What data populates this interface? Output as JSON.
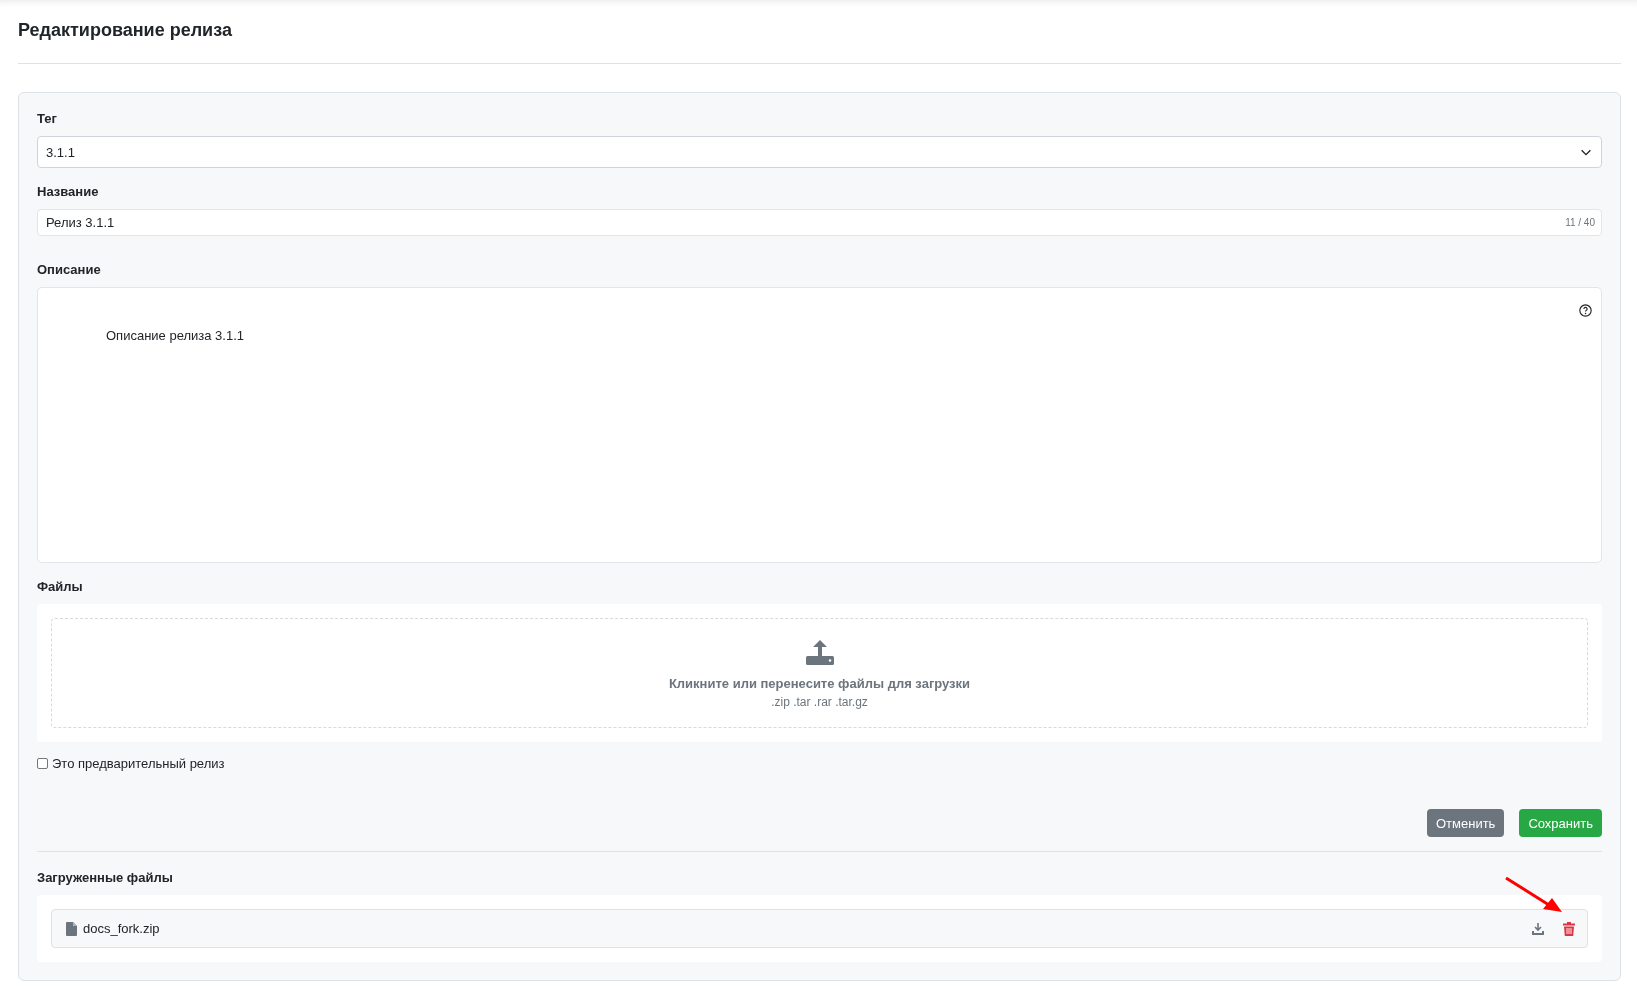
{
  "page": {
    "title": "Редактирование релиза"
  },
  "tag": {
    "label": "Тег",
    "value": "3.1.1"
  },
  "name": {
    "label": "Название",
    "value": "Релиз 3.1.1",
    "counter": "11 / 40"
  },
  "description": {
    "label": "Описание",
    "value": "Описание релиза 3.1.1"
  },
  "files": {
    "label": "Файлы",
    "dropzone_text": "Кликните или перенесите файлы для загрузки",
    "accepted_types": ".zip .tar .rar .tar.gz"
  },
  "prerelease": {
    "label": "Это предварительный релиз",
    "checked": false
  },
  "buttons": [
    {
      "kind": "cancel",
      "label": "Отменить"
    },
    {
      "kind": "save",
      "label": "Сохранить"
    }
  ],
  "uploaded": {
    "label": "Загруженные файлы",
    "items": [
      {
        "name": "docs_fork.zip"
      }
    ]
  }
}
